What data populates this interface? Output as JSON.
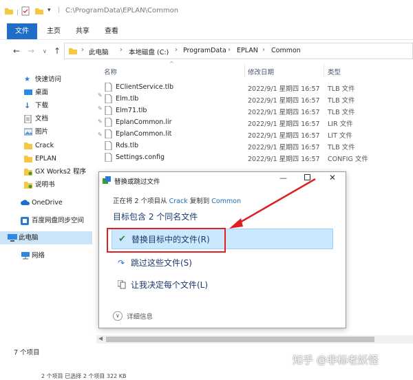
{
  "window": {
    "path_title": "C:\\ProgramData\\EPLAN\\Common"
  },
  "ribbon": {
    "tabs": [
      "文件",
      "主页",
      "共享",
      "查看"
    ]
  },
  "address": {
    "crumbs": [
      "此电脑",
      "本地磁盘 (C:)",
      "ProgramData",
      "EPLAN",
      "Common"
    ]
  },
  "nav": {
    "items": [
      {
        "label": "快速访问",
        "icon": "star-icon"
      },
      {
        "label": "桌面",
        "icon": "desktop-icon"
      },
      {
        "label": "下载",
        "icon": "download-icon"
      },
      {
        "label": "文档",
        "icon": "document-icon"
      },
      {
        "label": "图片",
        "icon": "picture-icon"
      },
      {
        "label": "Crack",
        "icon": "folder-icon"
      },
      {
        "label": "EPLAN",
        "icon": "folder-icon"
      },
      {
        "label": "GX Works2 程序",
        "icon": "folder-icon"
      },
      {
        "label": "说明书",
        "icon": "folder-icon"
      },
      {
        "label": "OneDrive",
        "icon": "cloud-icon"
      },
      {
        "label": "百度网盘同步空间",
        "icon": "sync-icon"
      },
      {
        "label": "此电脑",
        "icon": "computer-icon"
      },
      {
        "label": "网络",
        "icon": "network-icon"
      }
    ]
  },
  "columns": {
    "name": "名称",
    "date": "修改日期",
    "type": "类型"
  },
  "files": [
    {
      "name": "EClientService.tlb",
      "date": "2022/9/1 星期四 16:57",
      "type": "TLB 文件"
    },
    {
      "name": "Elm.tlb",
      "date": "2022/9/1 星期四 16:57",
      "type": "TLB 文件"
    },
    {
      "name": "Elm71.tlb",
      "date": "2022/9/1 星期四 16:57",
      "type": "TLB 文件"
    },
    {
      "name": "EplanCommon.lir",
      "date": "2022/9/1 星期四 16:57",
      "type": "LIR 文件"
    },
    {
      "name": "EplanCommon.lit",
      "date": "2022/9/1 星期四 16:57",
      "type": "LIT 文件"
    },
    {
      "name": "Rds.tlb",
      "date": "2022/9/1 星期四 16:57",
      "type": "TLB 文件"
    },
    {
      "name": "Settings.config",
      "date": "2022/9/1 星期四 16:57",
      "type": "CONFIG 文件"
    }
  ],
  "dialog": {
    "title": "替换或跳过文件",
    "info_prefix": "正在将 2 个项目从",
    "source": "Crack",
    "info_mid": "复制到",
    "dest": "Common",
    "heading": "目标包含 2 个同名文件",
    "options": [
      "替换目标中的文件(R)",
      "跳过这些文件(S)",
      "让我决定每个文件(L)"
    ],
    "details": "详细信息"
  },
  "status": {
    "count": "7 个项目",
    "footer": "2 个项目  已选择 2 个项目  322 KB"
  },
  "watermark": "知乎 @非标老妖怪",
  "colors": {
    "accent": "#1e6ec8",
    "selection": "#cce8ff",
    "callout": "#e02020"
  }
}
